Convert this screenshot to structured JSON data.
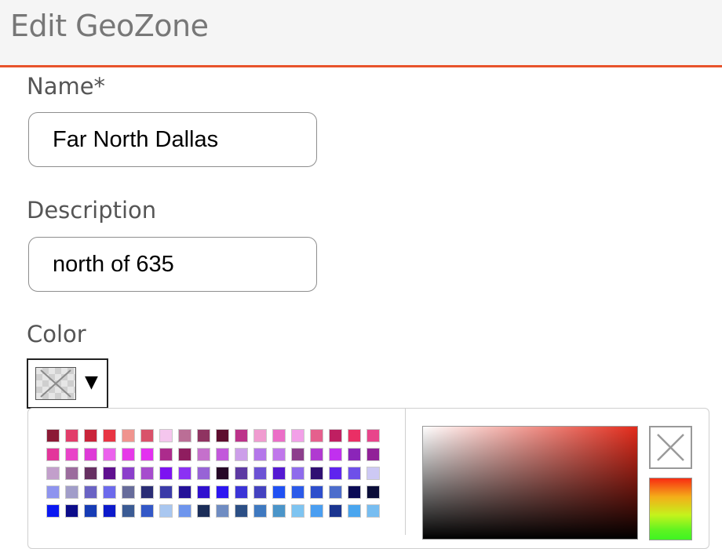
{
  "header": {
    "title": "Edit GeoZone"
  },
  "form": {
    "name": {
      "label": "Name*",
      "value": "Far North Dallas"
    },
    "description": {
      "label": "Description",
      "value": "north of 635"
    },
    "color": {
      "label": "Color",
      "dropdown_arrow": "▼",
      "selected": "none"
    }
  },
  "color_picker": {
    "palette_rows": [
      [
        "#8b1a35",
        "#e23d6a",
        "#c9243a",
        "#e83543",
        "#f0948e",
        "#d9526a",
        "#f5c6ee",
        "#bb6e96",
        "#8f3361",
        "#5d0d2e",
        "#bc338a",
        "#f09bd0",
        "#eb6ec7",
        "#f2a0e8",
        "#e5608d",
        "#bf1f61",
        "#ea2f65",
        "#e8458b"
      ],
      [
        "#e3369b",
        "#e943c8",
        "#de3ad7",
        "#eb62ec",
        "#e63ae8",
        "#e331f0",
        "#ac2b8c",
        "#8f1d5f",
        "#c570cc",
        "#c258db",
        "#cc9ee9",
        "#b477ea",
        "#c077eb",
        "#8d3f8c",
        "#b03ad1",
        "#c130ef",
        "#8b25b9",
        "#912198"
      ],
      [
        "#c29fcb",
        "#9b6c9d",
        "#663062",
        "#5e108e",
        "#8b3fcb",
        "#a64ccd",
        "#7c13f1",
        "#8b31f3",
        "#9763d6",
        "#260826",
        "#5d3aa3",
        "#6c52d5",
        "#5419d2",
        "#8e6bec",
        "#2f0f72",
        "#5f23ee",
        "#6e50e9",
        "#cdc9f4"
      ],
      [
        "#8e94ef",
        "#a19dc9",
        "#6a63c4",
        "#6c6aec",
        "#676c9b",
        "#2a2d75",
        "#3b3ba8",
        "#241199",
        "#2f10cf",
        "#2d16f1",
        "#3b34d7",
        "#4442c0",
        "#2151f3",
        "#2b5ae9",
        "#2d4ecc",
        "#4c6dcc",
        "#0b0b55",
        "#0b0d38"
      ],
      [
        "#0a18f2",
        "#0c0c8a",
        "#173cb5",
        "#0d1acb",
        "#3b5b94",
        "#3358c7",
        "#a9c7f0",
        "#6e95ed",
        "#1b2d58",
        "#6f8cc2",
        "#2c4f85",
        "#3f79c0",
        "#4b95c9",
        "#7ec4f1",
        "#4a9ef1",
        "#1b3590",
        "#4aa6ef",
        "#77bdf1"
      ]
    ],
    "clear_icon": "close-icon",
    "gradient_base_color": "#e22b1b"
  }
}
